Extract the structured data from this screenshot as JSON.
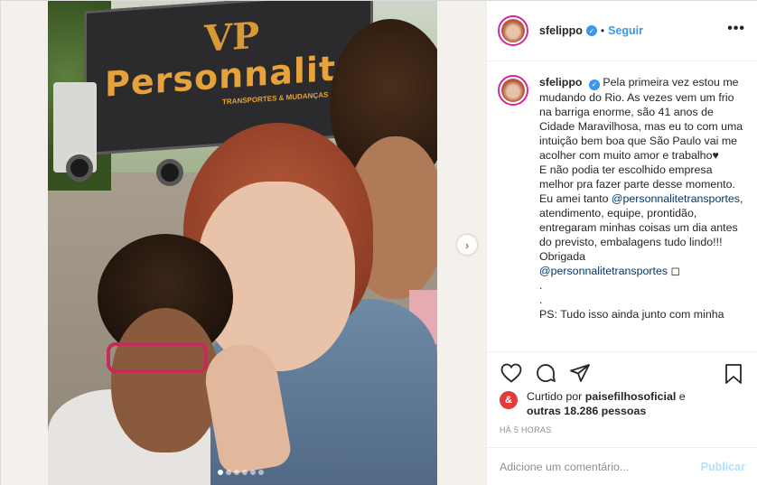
{
  "photo": {
    "truck_logo": "Personnalitê",
    "truck_logo_sub": "TRANSPORTES & MUDANÇAS",
    "next_icon": "chevron-right-icon",
    "slide_count": 6,
    "active_slide": 1
  },
  "header": {
    "username": "sfelippo",
    "separator": "•",
    "follow_label": "Seguir",
    "more_icon": "•••"
  },
  "caption": {
    "username": "sfelippo",
    "lines": [
      "Pela primeira vez estou me mudando do Rio. As vezes vem um frio na barriga enorme, são 41 anos de Cidade Maravilhosa, mas eu to com uma intuição bem boa que São Paulo vai me acolher com muito amor e trabalho♥",
      "E não podia ter escolhido empresa melhor pra fazer parte desse momento. Eu amei tanto"
    ],
    "mention1": "@personnalitetransportes",
    "line3": ", atendimento, equipe, prontidão, entregaram minhas coisas um dia antes do previsto, embalagens tudo lindo!!! Obrigada",
    "mention2": "@personnalitetransportes",
    "mention2_suffix": " ◻",
    "dot1": ".",
    "dot2": ".",
    "line4": "PS: Tudo isso ainda junto com minha"
  },
  "likes": {
    "avatar_letter": "&",
    "prefix": "Curtido por ",
    "user": "paisefilhosoficial",
    "middle": " e",
    "others": "outras 18.286 pessoas"
  },
  "time": "HÁ 5 HORAS",
  "comment": {
    "placeholder": "Adicione um comentário...",
    "publish_label": "Publicar"
  },
  "colors": {
    "link": "#3897f0",
    "mention": "#00376b",
    "publish_disabled": "#b2dffc",
    "muted": "#8e8e8e"
  }
}
